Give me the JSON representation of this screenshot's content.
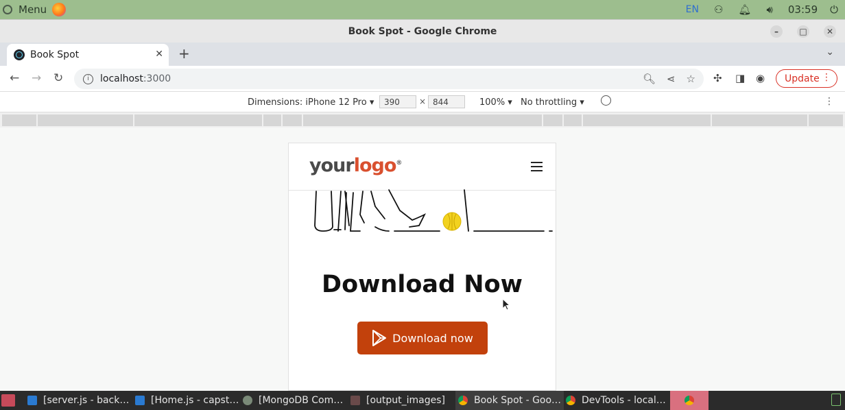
{
  "os_bar": {
    "menu_label": "Menu",
    "lang": "EN",
    "clock": "03:59"
  },
  "window": {
    "title": "Book Spot - Google Chrome"
  },
  "tabs": [
    {
      "label": "Book Spot"
    }
  ],
  "address": {
    "host": "localhost",
    "port": ":3000",
    "update_label": "Update"
  },
  "devtools": {
    "dimensions_label": "Dimensions: iPhone 12 Pro",
    "width": "390",
    "height": "844",
    "times": "×",
    "zoom": "100%",
    "throttling": "No throttling"
  },
  "page": {
    "logo_part1": "your",
    "logo_part2": "logo",
    "logo_mark": "®",
    "heading": "Download Now",
    "button_label": "Download now"
  },
  "taskbar": {
    "items": [
      "[server.js - back…",
      "[Home.js - capst…",
      "[MongoDB Com…",
      "[output_images]",
      "Book Spot - Goo…",
      "DevTools - local…"
    ]
  }
}
